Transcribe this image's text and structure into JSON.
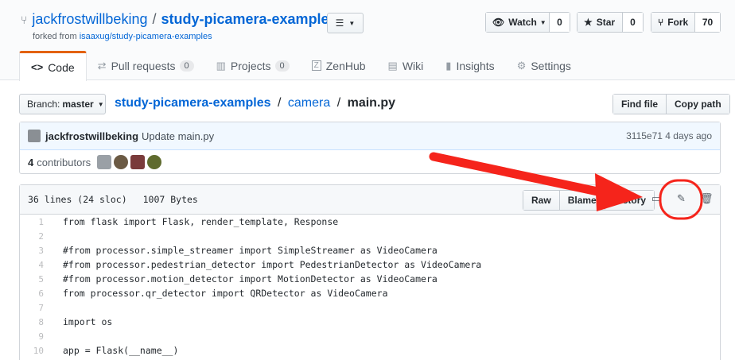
{
  "repo": {
    "owner": "jackfrostwillbeking",
    "name": "study-picamera-examples",
    "forked_prefix": "forked from ",
    "forked_source": "isaaxug/study-picamera-examples"
  },
  "actions": {
    "watch_label": "Watch",
    "watch_count": "0",
    "star_label": "Star",
    "star_count": "0",
    "fork_label": "Fork",
    "fork_count": "70"
  },
  "tabs": [
    {
      "label": "Code",
      "icon": "code-icon"
    },
    {
      "label": "Pull requests",
      "count": "0",
      "icon": "pull-request-icon"
    },
    {
      "label": "Projects",
      "count": "0",
      "icon": "project-icon"
    },
    {
      "label": "ZenHub",
      "icon": "zenhub-icon"
    },
    {
      "label": "Wiki",
      "icon": "book-icon"
    },
    {
      "label": "Insights",
      "icon": "graph-icon"
    },
    {
      "label": "Settings",
      "icon": "gear-icon"
    }
  ],
  "branch": {
    "prefix": "Branch:",
    "name": "master"
  },
  "breadcrumb": {
    "repo": "study-picamera-examples",
    "folder": "camera",
    "file": "main.py"
  },
  "file_buttons": {
    "find_file": "Find file",
    "copy_path": "Copy path"
  },
  "commit": {
    "author": "jackfrostwillbeking",
    "message": "Update main.py",
    "sha": "3115e71",
    "time": "4 days ago",
    "contributors_count": "4",
    "contributors_label": "contributors"
  },
  "file": {
    "lines_info": "36 lines (24 sloc)",
    "size": "1007 Bytes",
    "raw_label": "Raw",
    "blame_label": "Blame",
    "history_label": "History"
  },
  "code_lines": [
    {
      "n": "1",
      "text": "from flask import Flask, render_template, Response"
    },
    {
      "n": "2",
      "text": ""
    },
    {
      "n": "3",
      "text": "#from processor.simple_streamer import SimpleStreamer as VideoCamera"
    },
    {
      "n": "4",
      "text": "#from processor.pedestrian_detector import PedestrianDetector as VideoCamera"
    },
    {
      "n": "5",
      "text": "#from processor.motion_detector import MotionDetector as VideoCamera"
    },
    {
      "n": "6",
      "text": "from processor.qr_detector import QRDetector as VideoCamera"
    },
    {
      "n": "7",
      "text": ""
    },
    {
      "n": "8",
      "text": "import os"
    },
    {
      "n": "9",
      "text": ""
    },
    {
      "n": "10",
      "text": "app = Flask(__name__)"
    }
  ],
  "colors": {
    "annotation_red": "#f5241b",
    "link_blue": "#0366d6",
    "tab_accent": "#e36209"
  }
}
